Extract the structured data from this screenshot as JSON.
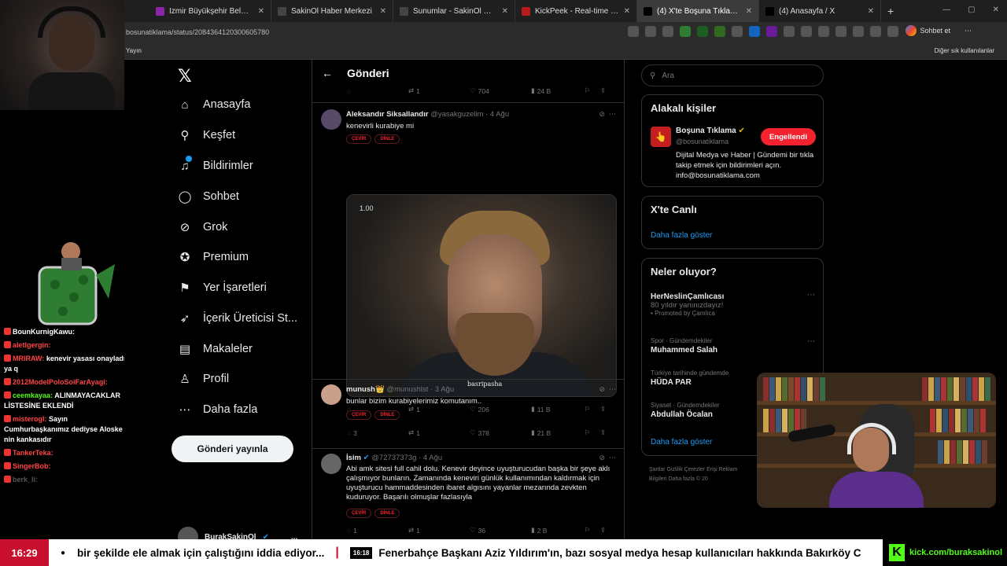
{
  "browser": {
    "tabs": [
      {
        "title": "İzmir Büyükşehir Belediyesi'nde y",
        "color": "#8e24aa"
      },
      {
        "title": "SakinOl Haber Merkezi",
        "color": "#444444"
      },
      {
        "title": "Sunumlar - SakinOl Haber Merke",
        "color": "#444444"
      },
      {
        "title": "KickPeek - Real-time URL Crawler",
        "color": "#b71c1c"
      },
      {
        "title": "(4) X'te Boşuna Tıklama: \"An",
        "color": "#000000",
        "active": true
      },
      {
        "title": "(4) Anasayfa / X",
        "color": "#000000"
      }
    ],
    "url": "bosunatiklama/status/2084364120300605780",
    "bookmarks_left": "Yayın",
    "bookmarks_right": "Diğer sık kullanılanlar",
    "profile_label": "Sohbet et"
  },
  "chat": {
    "messages": [
      {
        "user": "BounKurnigKawu:",
        "text": "",
        "user_color": "#ffffff"
      },
      {
        "user": "aletlgergin:",
        "text": "",
        "user_color": "#ff4444"
      },
      {
        "user": "MRIRAW:",
        "text": "kenevir yasası onayladı ya q",
        "user_color": "#ff4444"
      },
      {
        "user": "2012ModelPoloSoiFarAyagi:",
        "text": "",
        "user_color": "#ff4444"
      },
      {
        "user": "ceemkayaa:",
        "text": "ALINMAYACAKLAR LİSTESİNE EKLENDİ",
        "user_color": "#53fc18"
      },
      {
        "user": "misterogl:",
        "text": "Sayın Cumhurbaşkanımız dediyse Aloske nin kankasıdır",
        "user_color": "#ff4444"
      },
      {
        "user": "TankerTeka:",
        "text": "",
        "user_color": "#ff4444"
      },
      {
        "user": "SingerBob:",
        "text": "",
        "user_color": "#ff4444"
      },
      {
        "user": "berk_li:",
        "text": "",
        "user_color": "#555555"
      }
    ]
  },
  "xnav": {
    "items": [
      {
        "label": "Anasayfa",
        "icon": "home-icon",
        "glyph": "⌂"
      },
      {
        "label": "Keşfet",
        "icon": "search-icon",
        "glyph": "⚲"
      },
      {
        "label": "Bildirimler",
        "icon": "bell-icon",
        "glyph": "♫"
      },
      {
        "label": "Sohbet",
        "icon": "chat-icon",
        "glyph": "◯"
      },
      {
        "label": "Grok",
        "icon": "grok-icon",
        "glyph": "⊘"
      },
      {
        "label": "Premium",
        "icon": "premium-icon",
        "glyph": "✪"
      },
      {
        "label": "Yer İşaretleri",
        "icon": "bookmark-icon",
        "glyph": "⚑"
      },
      {
        "label": "İçerik Üreticisi St...",
        "icon": "rocket-icon",
        "glyph": "➶"
      },
      {
        "label": "Makaleler",
        "icon": "article-icon",
        "glyph": "▤"
      },
      {
        "label": "Profil",
        "icon": "profile-icon",
        "glyph": "♙"
      },
      {
        "label": "Daha fazla",
        "icon": "more-icon",
        "glyph": "⋯"
      }
    ],
    "notif_badge": "4",
    "post_button": "Gönderi yayınla",
    "account_name": "BurakSakinOl",
    "more": "..."
  },
  "main": {
    "back": "←",
    "title": "Gönderi",
    "top_actions": {
      "reply": "",
      "repost": "1",
      "like": "704",
      "views": "24 B"
    },
    "posts": [
      {
        "name": "Aleksandır Siksallandır",
        "handle": "@yasakguzelim · 4 Ağu",
        "text": "kenevirli kurabiye mi",
        "chips": [
          "ÇEVİR",
          "DİNLE"
        ],
        "actions": {
          "reply": "",
          "repost": "1",
          "like": "206",
          "views": "11 B"
        },
        "media": {
          "time": "1.00",
          "watermark": "basripasha"
        }
      },
      {
        "name": "munush👑",
        "handle": "@munushlst · 3 Ağu",
        "text": "bunlar bizim kurabiyelerimiz komutanım..",
        "chips": [
          "ÇEVİR",
          "DİNLE"
        ],
        "actions": {
          "reply": "3",
          "repost": "1",
          "like": "378",
          "views": "21 B"
        }
      },
      {
        "name": "İsim",
        "handle": "@72737373g · 4 Ağu",
        "text": "Abi amk sitesi full cahil dolu. Kenevir deyince uyuşturucudan başka bir şeye aklı çalışmıyor bunların. Zamanında keneviri günlük kullanımından kaldırmak için uyuşturucu hammaddesinden ibaret algısını yayanlar mezarında zevkten kuduruyor. Başarılı olmuşlar fazlasıyla",
        "chips": [
          "ÇEVİR",
          "DİNLE"
        ],
        "actions": {
          "reply": "1",
          "repost": "1",
          "like": "36",
          "views": "2 B"
        }
      }
    ]
  },
  "side": {
    "search_placeholder": "Ara",
    "related_title": "Alakalı kişiler",
    "related": {
      "name": "Boşuna Tıklama",
      "handle": "@bosunatiklama",
      "bio": "Dijital Medya ve Haber | Gündemi bir tıkla takip etmek için bildirimleri açın. info@bosunatiklama.com",
      "button": "Engellendi"
    },
    "live_title": "X'te Canlı",
    "live_more": "Daha fazla göster",
    "trends_title": "Neler oluyor?",
    "trends": [
      {
        "context": "",
        "name": "HerNeslinÇamlıcası",
        "sub": "80 yıldır yanınızdayız!",
        "promo": "Promoted by Çamlıca"
      },
      {
        "context": "Spor · Gündemdekiler",
        "name": "Muhammed Salah"
      },
      {
        "context": "Türkiye tarihinde gündemde",
        "name": "HÜDA PAR"
      },
      {
        "context": "Siyaset · Gündemdekiler",
        "name": "Abdullah Öcalan"
      }
    ],
    "trends_more": "Daha fazla göster",
    "footer": "Şartlar  Gizlilik  Çerezler  Erişi  Reklam Bilgileri  Daha fazla  © 20"
  },
  "ticker": {
    "clock": "16:29",
    "headline1": "bir şekilde ele almak için çalıştığını iddia ediyor...",
    "separator": "|",
    "time2": "16:18",
    "headline2": "Fenerbahçe Başkanı Aziz Yıldırım'ın, bazı sosyal medya hesap kullanıcıları hakkında Bakırköy C",
    "kick_logo": "K",
    "kick_url": "kick.com/buraksakinol"
  }
}
